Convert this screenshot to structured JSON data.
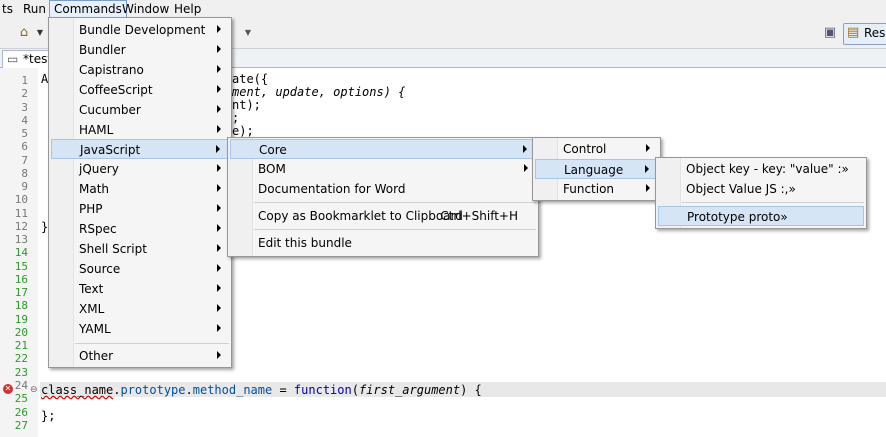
{
  "menubar": {
    "items": [
      "ts",
      "Run",
      "Commands",
      "Window",
      "Help"
    ]
  },
  "toolbar": {
    "perspective_label": "Reso"
  },
  "editor_tab": {
    "label": "*test_"
  },
  "editor": {
    "line_numbers": [
      "1",
      "2",
      "3",
      "4",
      "5",
      "6",
      "7",
      "8",
      "9",
      "10",
      "11",
      "12",
      "13",
      "14",
      "15",
      "16",
      "17",
      "18",
      "19",
      "20",
      "21",
      "22",
      "23",
      "24",
      "25",
      "26",
      "27"
    ],
    "line1_prefix": "A",
    "visible_fragments": [
      "ate({",
      "ment, update, options) {",
      "nt);",
      ";",
      "e);",
      "}"
    ],
    "line24": {
      "part1": "class_name",
      "dot1": ".",
      "part2": "prototype",
      "dot2": ".",
      "part3": "method_name",
      "eq": " = ",
      "fn": "function",
      "open": "(",
      "arg": "first_argument",
      "close": ") {"
    },
    "line26": "};"
  },
  "commands_menu": {
    "items": [
      "Bundle Development",
      "Bundler",
      "Capistrano",
      "CoffeeScript",
      "Cucumber",
      "HAML",
      "JavaScript",
      "jQuery",
      "Math",
      "PHP",
      "RSpec",
      "Shell Script",
      "Source",
      "Text",
      "XML",
      "YAML",
      "Other"
    ],
    "selected": "JavaScript"
  },
  "javascript_menu": {
    "core": "Core",
    "bom": "BOM",
    "doc": "Documentation for Word",
    "bookmarklet": "Copy as Bookmarklet to Clipboard",
    "bookmarklet_shortcut": "Ctrl+Shift+H",
    "edit": "Edit this bundle"
  },
  "core_menu": {
    "items": [
      "Control",
      "Language",
      "Function"
    ],
    "selected": "Language"
  },
  "language_menu": {
    "items": [
      "Object key - key: \"value\" :»",
      "Object Value JS :,»",
      "Prototype proto»"
    ],
    "selected": "Prototype proto»"
  }
}
